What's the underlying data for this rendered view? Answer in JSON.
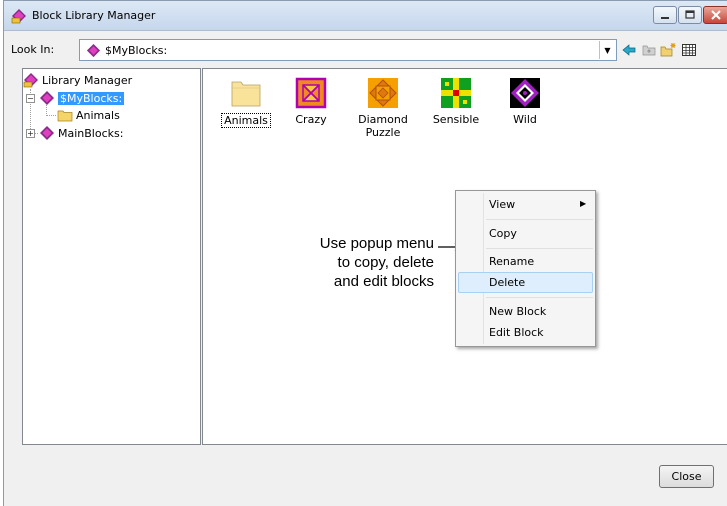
{
  "window": {
    "title": "Block Library Manager"
  },
  "lookin": {
    "label": "Look In:",
    "value": "$MyBlocks:"
  },
  "toolbar": {
    "icons": [
      "back-arrow-icon",
      "up-folder-icon",
      "new-folder-icon",
      "view-menu-icon"
    ]
  },
  "tree": {
    "root": "Library Manager",
    "items": [
      {
        "label": "$MyBlocks:",
        "selected": true,
        "expanded": true
      },
      {
        "label": "Animals",
        "type": "folder"
      },
      {
        "label": "MainBlocks:",
        "expanded": false
      }
    ]
  },
  "blocks": [
    {
      "label": "Animals",
      "type": "folder",
      "focused": true
    },
    {
      "label": "Crazy",
      "type": "block"
    },
    {
      "label": "Diamond Puzzle",
      "type": "block"
    },
    {
      "label": "Sensible",
      "type": "block"
    },
    {
      "label": "Wild",
      "type": "block"
    }
  ],
  "callout": {
    "line1": "Use popup menu",
    "line2": "to copy, delete",
    "line3": "and edit blocks"
  },
  "context_menu": {
    "items": [
      "View",
      "Copy",
      "Rename",
      "Delete",
      "New Block",
      "Edit Block"
    ],
    "highlighted": "Delete"
  },
  "buttons": {
    "close": "Close"
  },
  "colors": {
    "selection": "#3399ff",
    "menu_hover": "#dfeefc",
    "block_magenta": "#e040c0"
  }
}
